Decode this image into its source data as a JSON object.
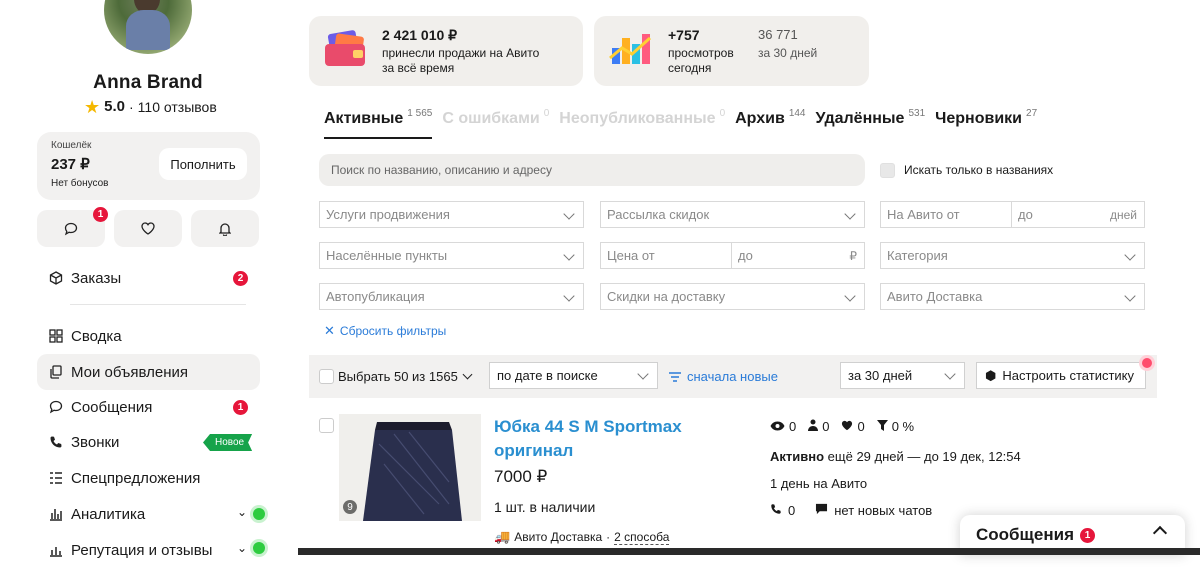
{
  "profile": {
    "name": "Anna Brand",
    "rating": "5.0",
    "reviews": "110 отзывов"
  },
  "wallet": {
    "label": "Кошелёк",
    "amount": "237 ₽",
    "bonus": "Нет бонусов",
    "topup": "Пополнить"
  },
  "quick": {
    "messages_badge": "1"
  },
  "nav": {
    "orders": {
      "label": "Заказы",
      "badge": "2"
    },
    "summary": "Сводка",
    "my_ads": "Мои объявления",
    "messages": {
      "label": "Сообщения",
      "badge": "1"
    },
    "calls": {
      "label": "Звонки",
      "tag": "Новое"
    },
    "offers": "Спецпредложения",
    "analytics": "Аналитика",
    "reputation": "Репутация и отзывы"
  },
  "stats": {
    "sales_amount": "2 421 010 ₽",
    "sales_line1": "принесли продажи на Авито",
    "sales_line2": "за всё время",
    "views_today": "+757",
    "views_line1": "просмотров",
    "views_line2": "сегодня",
    "views_30": "36 771",
    "views_30_label": "за 30 дней"
  },
  "tabs": [
    {
      "label": "Активные",
      "count": "1 565"
    },
    {
      "label": "С ошибками",
      "count": "0"
    },
    {
      "label": "Неопубликованные",
      "count": "0"
    },
    {
      "label": "Архив",
      "count": "144"
    },
    {
      "label": "Удалённые",
      "count": "531"
    },
    {
      "label": "Черновики",
      "count": "27"
    }
  ],
  "search": {
    "placeholder": "Поиск по названию, описанию и адресу",
    "only_titles": "Искать только в названиях"
  },
  "filters": {
    "promo": "Услуги продвижения",
    "discount_mail": "Рассылка скидок",
    "on_avito_from": "На Авито от",
    "to": "до",
    "days": "дней",
    "localities": "Населённые пункты",
    "price_from": "Цена от",
    "rub": "₽",
    "category": "Категория",
    "autopub": "Автопубликация",
    "delivery_discounts": "Скидки на доставку",
    "avito_delivery": "Авито Доставка",
    "reset": "Сбросить фильтры"
  },
  "toolbar": {
    "select": "Выбрать 50 из 1565",
    "sort": "по дате в поиске",
    "order": "сначала новые",
    "period": "за 30 дней",
    "stats_btn": "Настроить статистику"
  },
  "listing": {
    "title": "Юбка 44 S M Sportmax оригинал",
    "price": "7000 ₽",
    "stock": "1 шт. в наличии",
    "delivery": "Авито Доставка",
    "delivery_sep": "·",
    "delivery_ways": "2 способа",
    "photo_count": "9",
    "views": "0",
    "contacts": "0",
    "favorites": "0",
    "conversion": "0 %",
    "status_bold": "Активно",
    "status_rest": "ещё 29 дней — до 19 дек, 12:54",
    "days_on": "1 день на Авито",
    "calls": "0",
    "chats": "нет новых чатов"
  },
  "messages_panel": {
    "label": "Сообщения",
    "badge": "1"
  }
}
